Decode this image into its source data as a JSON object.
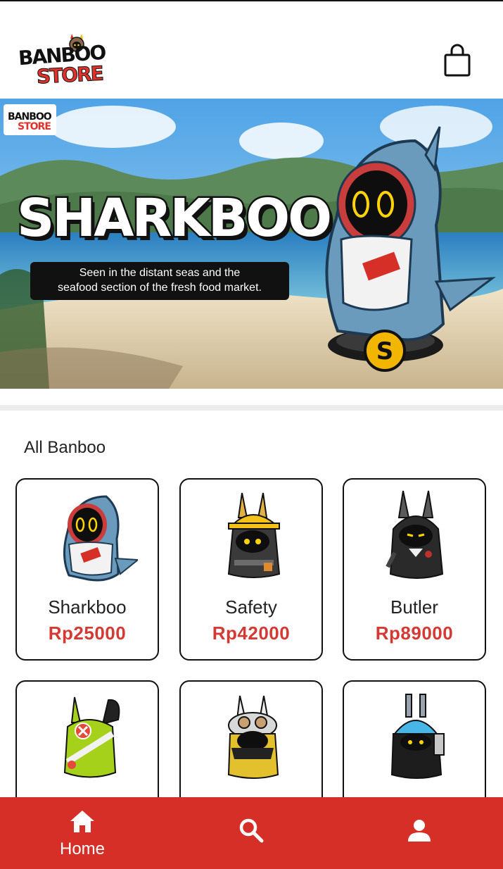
{
  "header": {
    "logo_line1": "BANBOO",
    "logo_line2": "STORE",
    "cart_icon": "shopping-bag-icon"
  },
  "banner": {
    "badge_line1": "BANBOO",
    "badge_line2": "STORE",
    "title": "SHARKBOO",
    "subtitle_line1": "Seen in the distant seas and the",
    "subtitle_line2": "seafood section of the fresh food market."
  },
  "section": {
    "title": "All Banboo"
  },
  "products": [
    {
      "name": "Sharkboo",
      "price": "Rp25000",
      "icon": "sharkboo-figure"
    },
    {
      "name": "Safety",
      "price": "Rp42000",
      "icon": "safety-figure"
    },
    {
      "name": "Butler",
      "price": "Rp89000",
      "icon": "butler-figure"
    },
    {
      "name": "",
      "price": "",
      "icon": "green-banboo-figure"
    },
    {
      "name": "",
      "price": "",
      "icon": "aviator-banboo-figure"
    },
    {
      "name": "",
      "price": "",
      "icon": "robot-banboo-figure"
    }
  ],
  "bottom_nav": {
    "home_label": "Home",
    "home_icon": "home-icon",
    "search_icon": "search-icon",
    "profile_icon": "person-icon"
  },
  "colors": {
    "accent": "#d52f27",
    "price": "#d43a33"
  }
}
